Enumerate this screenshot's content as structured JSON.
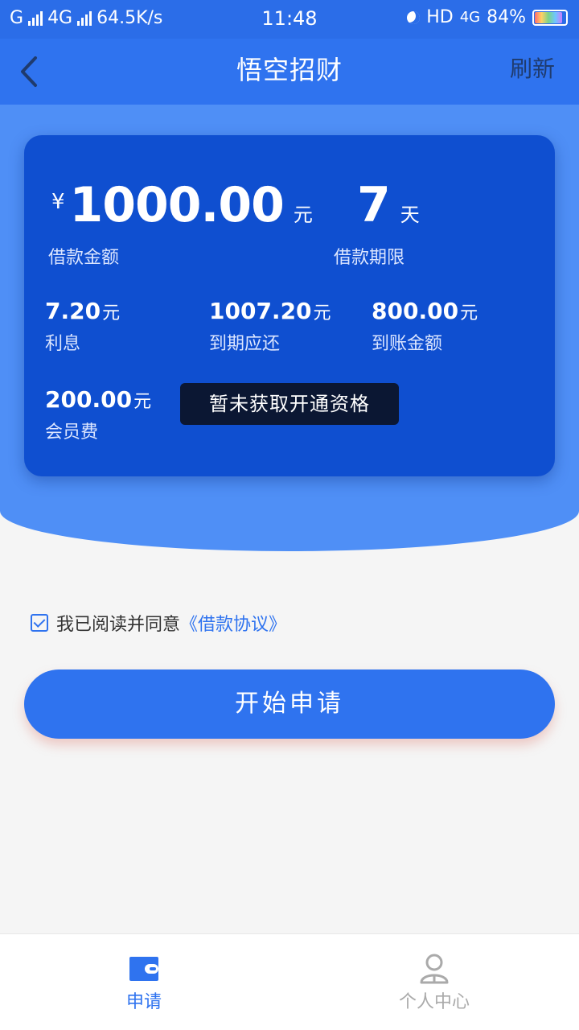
{
  "status_bar": {
    "carrier_left": "G",
    "network": "4G",
    "speed": "64.5K/s",
    "time": "11:48",
    "hd": "HD",
    "net2": "4G",
    "battery": "84%"
  },
  "nav": {
    "title": "悟空招财",
    "refresh": "刷新"
  },
  "loan": {
    "currency": "¥",
    "amount": "1000.00",
    "amount_unit": "元",
    "amount_label": "借款金额",
    "term": "7",
    "term_unit": "天",
    "term_label": "借款期限"
  },
  "stats": [
    {
      "value": "7.20",
      "unit": "元",
      "label": "利息"
    },
    {
      "value": "1007.20",
      "unit": "元",
      "label": "到期应还"
    },
    {
      "value": "800.00",
      "unit": "元",
      "label": "到账金额"
    },
    {
      "value": "200.00",
      "unit": "元",
      "label": "会员费"
    }
  ],
  "tooltip": "暂未获取开通资格",
  "agreement": {
    "text": "我已阅读并同意",
    "link": "《借款协议》"
  },
  "apply_button": "开始申请",
  "tabs": [
    {
      "label": "申请",
      "icon": "wallet-icon"
    },
    {
      "label": "个人中心",
      "icon": "user-icon"
    }
  ],
  "colors": {
    "primary": "#2f73ef",
    "card": "#0f4fd0",
    "hero": "#4f8ff6"
  }
}
